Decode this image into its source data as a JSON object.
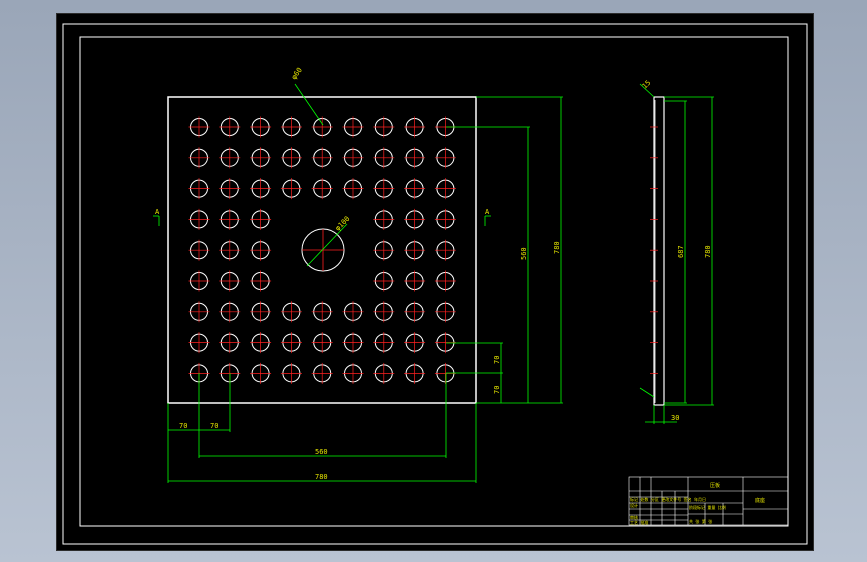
{
  "drawing": {
    "plate_dims": {
      "width_overall": "780",
      "height_overall": "780",
      "hole_span_h": "560",
      "hole_span_v": "560",
      "pitch_x1": "70",
      "pitch_x2": "70",
      "pitch_y1": "70",
      "pitch_y2": "70",
      "hole_dia": "φ60",
      "center_hole_dia": "φ100"
    },
    "side_dims": {
      "height_overall": "780",
      "height_inner": "687",
      "thickness": "30",
      "small_label": "15"
    },
    "section_marker": "A",
    "title_block": {
      "title": "压板",
      "drawing_name": "底座",
      "rows": [
        "标记 处数 分区 更改文件号 签名 年月日",
        "设计",
        "审核",
        "工艺 批准"
      ],
      "codes": [
        "阶段标记 重量 比例",
        "共 张 第 张"
      ]
    },
    "colors": {
      "background": "#000000",
      "plate": "#ffffff",
      "dimension": "#00ff00",
      "center": "#ff2020",
      "text": "#e6e600"
    }
  }
}
